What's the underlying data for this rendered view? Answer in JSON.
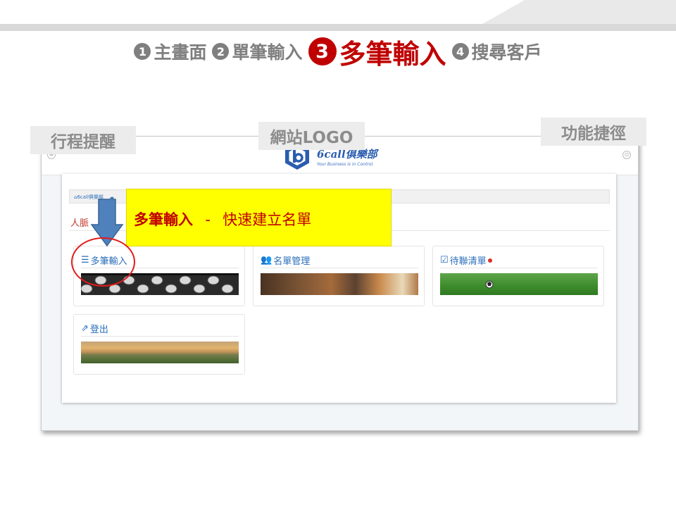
{
  "steps": [
    {
      "num": "1",
      "label": "主畫面",
      "active": false
    },
    {
      "num": "2",
      "label": "單筆輸入",
      "active": false
    },
    {
      "num": "3",
      "label": "多筆輸入",
      "active": true
    },
    {
      "num": "4",
      "label": "搜尋客戶",
      "active": false
    }
  ],
  "callouts": {
    "left": "行程提醒",
    "mid": "網站LOGO",
    "right": "功能捷徑"
  },
  "app": {
    "logo_name": "6call俱樂部",
    "logo_slogan": "Your Business is in Control.",
    "breadcrumb": "6call俱樂部",
    "section_title": "人脈",
    "tiles": [
      {
        "label": "多筆輸入",
        "icon": "list-icon"
      },
      {
        "label": "名單管理",
        "icon": "users-icon"
      },
      {
        "label": "待聯清單",
        "icon": "calendar-check-icon"
      },
      {
        "label": "登出",
        "icon": "share-icon"
      }
    ]
  },
  "annotation": {
    "title": "多筆輸入",
    "separator": "-",
    "description": "快速建立名單"
  },
  "colors": {
    "accent_red": "#c00000",
    "step_grey": "#7f7f7f",
    "link_blue": "#2a6ebb",
    "highlight_yellow": "#ffff00",
    "arrow_blue": "#4f81bd"
  }
}
